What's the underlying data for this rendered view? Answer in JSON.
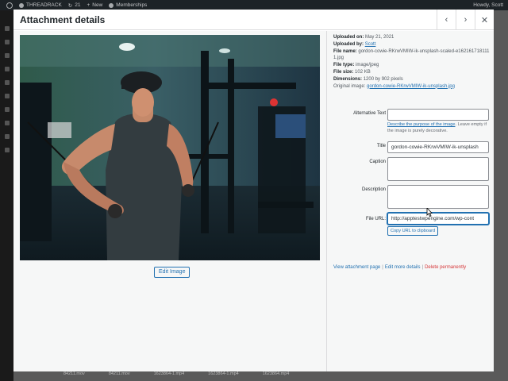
{
  "admin_bar": {
    "site_name": "THREADRACK",
    "updates": "21",
    "new_label": "New",
    "memberships": "Memberships",
    "user_greeting": "Howdy, Scott"
  },
  "modal": {
    "title": "Attachment details",
    "prev_icon": "chevron-left-icon",
    "next_icon": "chevron-right-icon",
    "close_icon": "close-icon"
  },
  "media": {
    "edit_image_label": "Edit Image"
  },
  "details": {
    "uploaded_on_label": "Uploaded on:",
    "uploaded_on": "May 21, 2021",
    "uploaded_by_label": "Uploaded by:",
    "uploaded_by": "Scott",
    "file_name_label": "File name:",
    "file_name": "gordon-cowie-RKrwVMIW-ik-unsplash-scaled-e1621617181111.jpg",
    "file_type_label": "File type:",
    "file_type": "image/jpeg",
    "file_size_label": "File size:",
    "file_size": "102 KB",
    "dimensions_label": "Dimensions:",
    "dimensions": "1200 by 902 pixels",
    "original_image_label": "Original image:",
    "original_image": "gordon-cowie-RKrwVMIW-ik-unsplash.jpg"
  },
  "form": {
    "alt_label": "Alternative Text",
    "alt_value": "",
    "alt_help_link": "Describe the purpose of the image",
    "alt_help_rest": ". Leave empty if the image is purely decorative.",
    "title_label": "Title",
    "title_value": "gordon-cowie-RKrwVMIW-ik-unsplash",
    "caption_label": "Caption",
    "caption_value": "",
    "description_label": "Description",
    "description_value": "",
    "file_url_label": "File URL:",
    "file_url_value": "http://apptestwpengine.com/wp-cont",
    "copy_url_label": "Copy URL to clipboard"
  },
  "actions": {
    "view_page": "View attachment page",
    "edit_more": "Edit more details",
    "delete": "Delete permanently",
    "separator": "|"
  },
  "background_files": [
    "84211.mov",
    "84211.mov",
    "1623864-1.mp4",
    "1623864-1.mp4",
    "1623864.mp4"
  ]
}
